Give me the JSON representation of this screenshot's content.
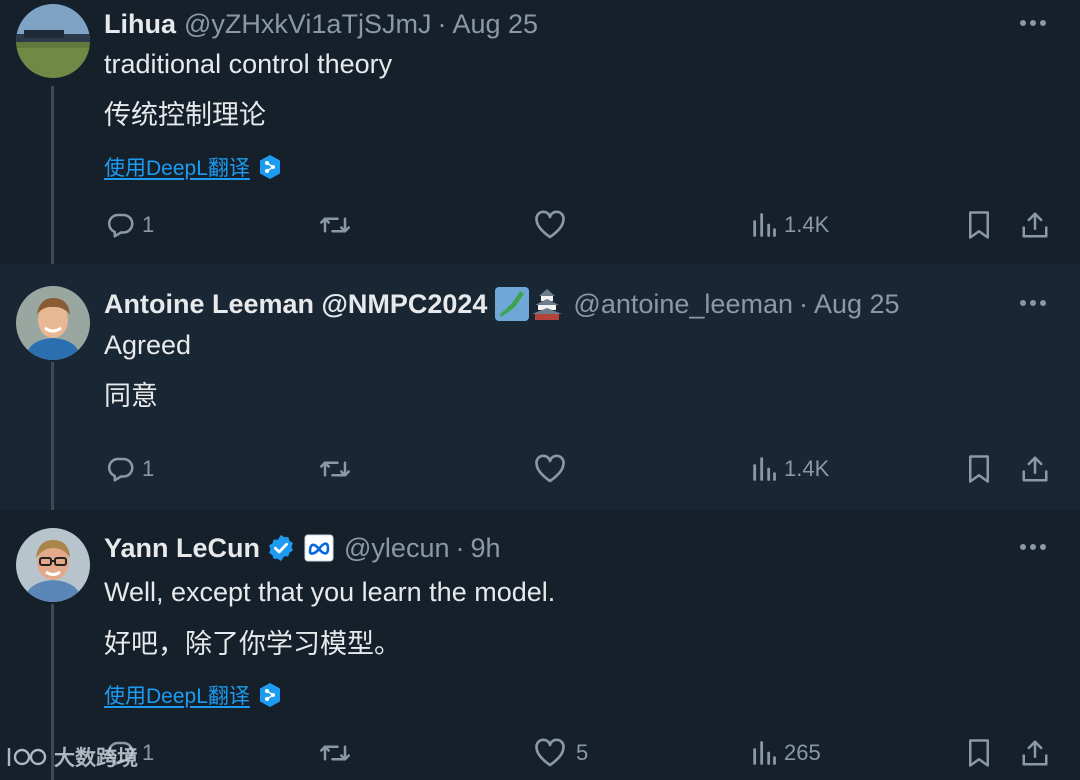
{
  "tweets": [
    {
      "name": "Lihua",
      "handle": "@yZHxkVi1aTjSJmJ",
      "separator": "·",
      "time": "Aug 25",
      "text": "traditional control theory",
      "translation": "传统控制理论",
      "translate_link": "使用DeepL翻译",
      "replies": "1",
      "retweets": "",
      "likes": "",
      "views": "1.4K"
    },
    {
      "name": "Antoine Leeman @NMPC2024",
      "handle": "@antoine_leeman",
      "separator": "·",
      "time": "Aug 25",
      "text": "Agreed",
      "translation": "同意",
      "translate_link": "",
      "replies": "1",
      "retweets": "",
      "likes": "",
      "views": "1.4K"
    },
    {
      "name": "Yann LeCun",
      "handle": "@ylecun",
      "separator": "·",
      "time": "9h",
      "text": "Well, except that you learn the model.",
      "translation": "好吧，除了你学习模型。",
      "translate_link": "使用DeepL翻译",
      "replies": "1",
      "retweets": "",
      "likes": "5",
      "views": "265"
    }
  ],
  "watermark": "大数跨境",
  "colors": {
    "background": "#15202b",
    "highlight_background": "#192734",
    "text": "#e7e9ea",
    "muted": "#8b98a5",
    "link": "#1d9bf0",
    "verified": "#1d9bf0"
  },
  "icons": [
    "reply-icon",
    "retweet-icon",
    "like-icon",
    "views-icon",
    "bookmark-icon",
    "share-icon",
    "more-icon",
    "verified-badge-icon",
    "meta-affiliate-icon",
    "japan-map-emoji",
    "japanese-castle-emoji",
    "deepl-icon"
  ]
}
